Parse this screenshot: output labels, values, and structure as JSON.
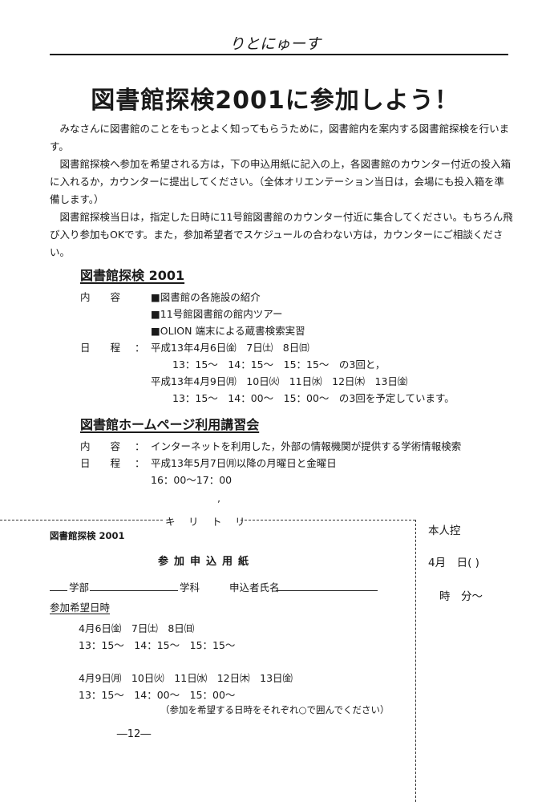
{
  "header": {
    "title": "りとにゅーす"
  },
  "article": {
    "title": "図書館探検2001に参加しよう！",
    "paragraphs": [
      "みなさんに図書館のことをもっとよく知ってもらうために，図書館内を案内する図書館探検を行います。",
      "図書館探検へ参加を希望される方は，下の申込用紙に記入の上，各図書館のカウンター付近の投入箱に入れるか，カウンターに提出してください。（全体オリエンテーション当日は，会場にも投入箱を準備します。）",
      "図書館探検当日は，指定した日時に11号館図書館のカウンター付近に集合してください。もちろん飛び入り参加もOKです。また，参加希望者でスケジュールの合わない方は，カウンターにご相談ください。"
    ]
  },
  "section1": {
    "title": "図書館探検 2001",
    "content_label": "内　　容",
    "content_items": [
      "■図書館の各施設の紹介",
      "■11号館図書館の館内ツアー",
      "■OLION 端末による蔵書検索実習"
    ],
    "schedule_label": "日　　程",
    "colon": "：",
    "schedule_lines": [
      "平成13年4月6日㈮　7日㈯　8日㈰",
      "13：15～　14：15～　15：15～　の3回と，",
      "平成13年4月9日㈪　10日㈫　11日㈬　12日㈭　13日㈮",
      "13：15～　14：00～　15：00～　の3回を予定しています。"
    ]
  },
  "section2": {
    "title": "図書館ホームページ利用講習会",
    "content_label": "内　　容",
    "content_text": "インターネットを利用した，外部の情報機関が提供する学術情報検索",
    "schedule_label": "日　　程",
    "schedule_lines": [
      "平成13年5月7日㈪以降の月曜日と金曜日",
      "16：00～17：00"
    ],
    "colon": "："
  },
  "cut_line": {
    "label": "キ　リ　ト　リ",
    "mark": "’"
  },
  "form": {
    "small_title": "図書館探検 2001",
    "heading": "参加申込用紙",
    "dept_label": "学部",
    "course_label": "学科",
    "applicant_label": "申込者氏名",
    "pref_label": "参加希望日時",
    "lines": [
      "4月6日㈮　7日㈯　8日㈰",
      "13：15～　14：15～　15：15～",
      "4月9日㈪　10日㈫　11日㈬　12日㈭　13日㈮",
      "13：15～　14：00～　15：00～"
    ],
    "note": "（参加を希望する日時をそれぞれ○で囲んでください）"
  },
  "stub": {
    "title": "本人控",
    "date": "4月　日(  )",
    "time": "時　分～"
  },
  "page_number": "―12―"
}
